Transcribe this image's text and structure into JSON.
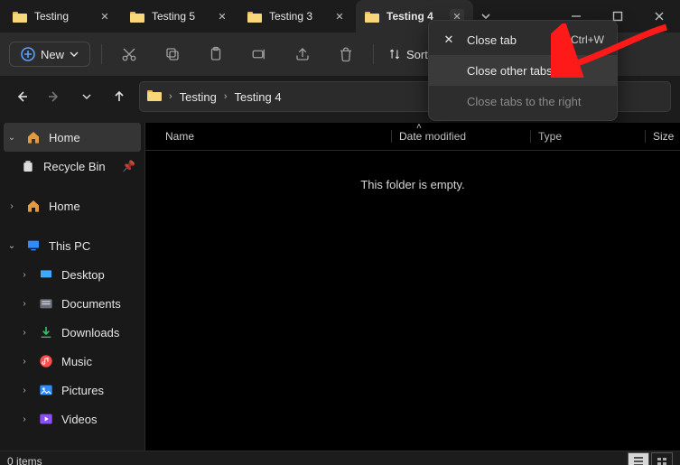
{
  "tabs": [
    {
      "label": "Testing"
    },
    {
      "label": "Testing 5"
    },
    {
      "label": "Testing 3"
    },
    {
      "label": "Testing 4",
      "active": true,
      "labelTrunc": "Testing 4"
    }
  ],
  "toolbar": {
    "new_label": "New",
    "sort_label": "Sort"
  },
  "breadcrumb": {
    "seg1": "Testing",
    "seg2": "Testing 4"
  },
  "columns": {
    "name": "Name",
    "date": "Date modified",
    "type": "Type",
    "size": "Size"
  },
  "empty_msg": "This folder is empty.",
  "sidebar": {
    "home": "Home",
    "recycle": "Recycle Bin",
    "home2": "Home",
    "thispc": "This PC",
    "desktop": "Desktop",
    "documents": "Documents",
    "downloads": "Downloads",
    "music": "Music",
    "pictures": "Pictures",
    "videos": "Videos"
  },
  "status": {
    "items": "0 items"
  },
  "context_menu": {
    "close_tab": "Close tab",
    "close_tab_shortcut": "Ctrl+W",
    "close_other": "Close other tabs",
    "close_right": "Close tabs to the right"
  }
}
